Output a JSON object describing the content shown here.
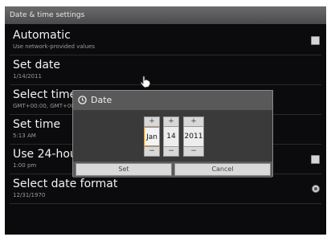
{
  "window": {
    "title": "Date & time settings"
  },
  "settings": [
    {
      "title": "Automatic",
      "subtitle": "Use network-provided values",
      "control": "checkbox"
    },
    {
      "title": "Set date",
      "subtitle": "1/14/2011"
    },
    {
      "title": "Select time zo",
      "subtitle": "GMT+00:00, GMT+00"
    },
    {
      "title": "Set time",
      "subtitle": "5:13 AM"
    },
    {
      "title": "Use 24-hour",
      "subtitle": "1:00 pm",
      "control": "checkbox"
    },
    {
      "title": "Select date format",
      "subtitle": "12/31/1970",
      "control": "radio"
    }
  ],
  "date_dialog": {
    "title": "Date",
    "month": "Jan",
    "day": "14",
    "year": "2011",
    "increment_glyph": "+",
    "decrement_glyph": "−",
    "set_label": "Set",
    "cancel_label": "Cancel"
  },
  "icons": {
    "clock": "clock-icon",
    "cursor": "hand-cursor-icon"
  },
  "colors": {
    "background": "#0b0b0d",
    "focus_accent": "#d78f20",
    "dialog_bg": "#646466"
  }
}
